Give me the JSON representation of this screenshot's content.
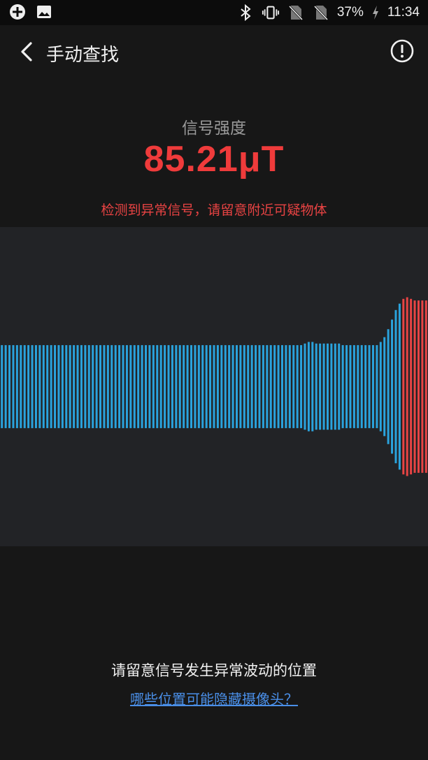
{
  "status_bar": {
    "battery": "37%",
    "time": "11:34",
    "icons": [
      "app-plus-icon",
      "image-icon",
      "bluetooth-icon",
      "vibrate-icon",
      "no-sim-icon",
      "no-sim-icon",
      "charging-icon"
    ]
  },
  "header": {
    "title": "手动查找",
    "back_icon": "chevron-left-icon",
    "info_icon": "info-circle-icon"
  },
  "signal": {
    "label": "信号强度",
    "value": "85.21μT",
    "warning": "检测到异常信号，请留意附近可疑物体"
  },
  "waveform": {
    "normal_color": "#2aa3dd",
    "alert_color": "#e84444",
    "background": "#222326",
    "bars": [
      {
        "amp": 0.26,
        "alert": false
      },
      {
        "amp": 0.26,
        "alert": false
      },
      {
        "amp": 0.26,
        "alert": false
      },
      {
        "amp": 0.26,
        "alert": false
      },
      {
        "amp": 0.26,
        "alert": false
      },
      {
        "amp": 0.26,
        "alert": false
      },
      {
        "amp": 0.26,
        "alert": false
      },
      {
        "amp": 0.26,
        "alert": false
      },
      {
        "amp": 0.26,
        "alert": false
      },
      {
        "amp": 0.26,
        "alert": false
      },
      {
        "amp": 0.26,
        "alert": false
      },
      {
        "amp": 0.26,
        "alert": false
      },
      {
        "amp": 0.26,
        "alert": false
      },
      {
        "amp": 0.26,
        "alert": false
      },
      {
        "amp": 0.26,
        "alert": false
      },
      {
        "amp": 0.26,
        "alert": false
      },
      {
        "amp": 0.26,
        "alert": false
      },
      {
        "amp": 0.26,
        "alert": false
      },
      {
        "amp": 0.26,
        "alert": false
      },
      {
        "amp": 0.26,
        "alert": false
      },
      {
        "amp": 0.26,
        "alert": false
      },
      {
        "amp": 0.26,
        "alert": false
      },
      {
        "amp": 0.26,
        "alert": false
      },
      {
        "amp": 0.26,
        "alert": false
      },
      {
        "amp": 0.26,
        "alert": false
      },
      {
        "amp": 0.26,
        "alert": false
      },
      {
        "amp": 0.26,
        "alert": false
      },
      {
        "amp": 0.26,
        "alert": false
      },
      {
        "amp": 0.26,
        "alert": false
      },
      {
        "amp": 0.26,
        "alert": false
      },
      {
        "amp": 0.26,
        "alert": false
      },
      {
        "amp": 0.26,
        "alert": false
      },
      {
        "amp": 0.26,
        "alert": false
      },
      {
        "amp": 0.26,
        "alert": false
      },
      {
        "amp": 0.26,
        "alert": false
      },
      {
        "amp": 0.26,
        "alert": false
      },
      {
        "amp": 0.26,
        "alert": false
      },
      {
        "amp": 0.26,
        "alert": false
      },
      {
        "amp": 0.26,
        "alert": false
      },
      {
        "amp": 0.26,
        "alert": false
      },
      {
        "amp": 0.26,
        "alert": false
      },
      {
        "amp": 0.26,
        "alert": false
      },
      {
        "amp": 0.26,
        "alert": false
      },
      {
        "amp": 0.26,
        "alert": false
      },
      {
        "amp": 0.26,
        "alert": false
      },
      {
        "amp": 0.26,
        "alert": false
      },
      {
        "amp": 0.26,
        "alert": false
      },
      {
        "amp": 0.26,
        "alert": false
      },
      {
        "amp": 0.26,
        "alert": false
      },
      {
        "amp": 0.26,
        "alert": false
      },
      {
        "amp": 0.26,
        "alert": false
      },
      {
        "amp": 0.26,
        "alert": false
      },
      {
        "amp": 0.26,
        "alert": false
      },
      {
        "amp": 0.26,
        "alert": false
      },
      {
        "amp": 0.26,
        "alert": false
      },
      {
        "amp": 0.26,
        "alert": false
      },
      {
        "amp": 0.26,
        "alert": false
      },
      {
        "amp": 0.26,
        "alert": false
      },
      {
        "amp": 0.26,
        "alert": false
      },
      {
        "amp": 0.26,
        "alert": false
      },
      {
        "amp": 0.26,
        "alert": false
      },
      {
        "amp": 0.26,
        "alert": false
      },
      {
        "amp": 0.26,
        "alert": false
      },
      {
        "amp": 0.26,
        "alert": false
      },
      {
        "amp": 0.26,
        "alert": false
      },
      {
        "amp": 0.26,
        "alert": false
      },
      {
        "amp": 0.26,
        "alert": false
      },
      {
        "amp": 0.26,
        "alert": false
      },
      {
        "amp": 0.26,
        "alert": false
      },
      {
        "amp": 0.26,
        "alert": false
      },
      {
        "amp": 0.26,
        "alert": false
      },
      {
        "amp": 0.26,
        "alert": false
      },
      {
        "amp": 0.26,
        "alert": false
      },
      {
        "amp": 0.26,
        "alert": false
      },
      {
        "amp": 0.26,
        "alert": false
      },
      {
        "amp": 0.26,
        "alert": false
      },
      {
        "amp": 0.26,
        "alert": false
      },
      {
        "amp": 0.26,
        "alert": false
      },
      {
        "amp": 0.26,
        "alert": false
      },
      {
        "amp": 0.26,
        "alert": false
      },
      {
        "amp": 0.27,
        "alert": false
      },
      {
        "amp": 0.28,
        "alert": false
      },
      {
        "amp": 0.28,
        "alert": false
      },
      {
        "amp": 0.27,
        "alert": false
      },
      {
        "amp": 0.27,
        "alert": false
      },
      {
        "amp": 0.27,
        "alert": false
      },
      {
        "amp": 0.27,
        "alert": false
      },
      {
        "amp": 0.27,
        "alert": false
      },
      {
        "amp": 0.27,
        "alert": false
      },
      {
        "amp": 0.27,
        "alert": false
      },
      {
        "amp": 0.26,
        "alert": false
      },
      {
        "amp": 0.26,
        "alert": false
      },
      {
        "amp": 0.26,
        "alert": false
      },
      {
        "amp": 0.26,
        "alert": false
      },
      {
        "amp": 0.26,
        "alert": false
      },
      {
        "amp": 0.26,
        "alert": false
      },
      {
        "amp": 0.26,
        "alert": false
      },
      {
        "amp": 0.26,
        "alert": false
      },
      {
        "amp": 0.26,
        "alert": false
      },
      {
        "amp": 0.26,
        "alert": false
      },
      {
        "amp": 0.28,
        "alert": false
      },
      {
        "amp": 0.31,
        "alert": false
      },
      {
        "amp": 0.36,
        "alert": false
      },
      {
        "amp": 0.42,
        "alert": false
      },
      {
        "amp": 0.48,
        "alert": false
      },
      {
        "amp": 0.52,
        "alert": false
      },
      {
        "amp": 0.55,
        "alert": true
      },
      {
        "amp": 0.56,
        "alert": true
      },
      {
        "amp": 0.55,
        "alert": true
      },
      {
        "amp": 0.54,
        "alert": true
      },
      {
        "amp": 0.54,
        "alert": true
      },
      {
        "amp": 0.54,
        "alert": true
      },
      {
        "amp": 0.54,
        "alert": true
      }
    ]
  },
  "footer": {
    "hint": "请留意信号发生异常波动的位置",
    "link": "哪些位置可能隐藏摄像头？"
  }
}
